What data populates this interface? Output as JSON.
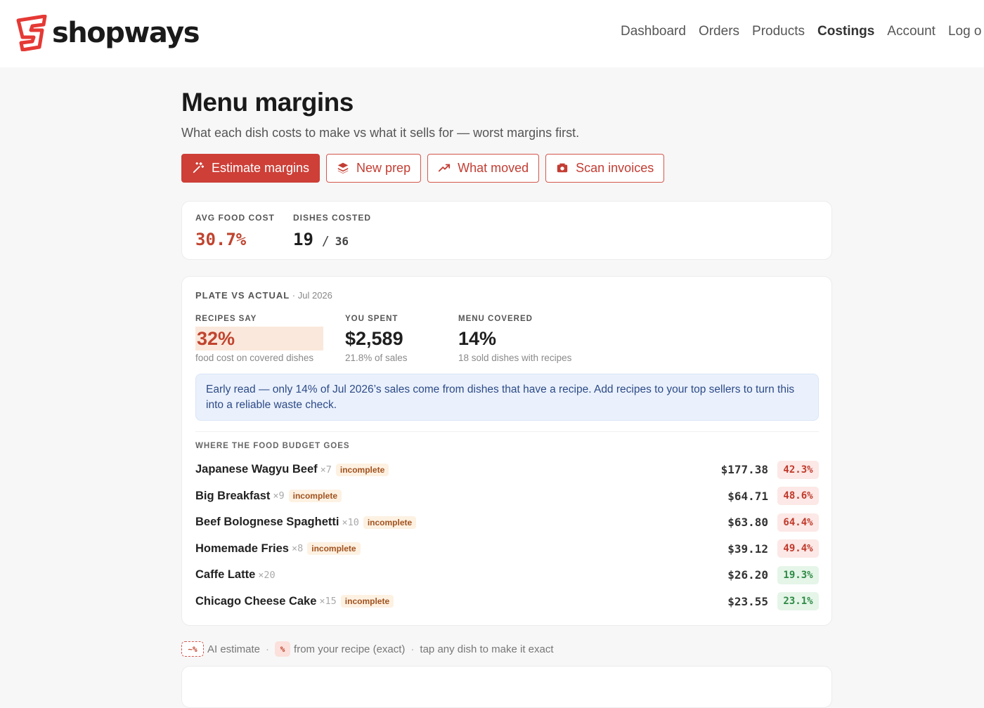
{
  "brand": {
    "name": "shopways",
    "logo_color": "#e53935"
  },
  "nav": {
    "items": [
      {
        "label": "Dashboard",
        "active": false
      },
      {
        "label": "Orders",
        "active": false
      },
      {
        "label": "Products",
        "active": false
      },
      {
        "label": "Costings",
        "active": true
      },
      {
        "label": "Account",
        "active": false
      },
      {
        "label": "Log o",
        "active": false
      }
    ]
  },
  "page": {
    "title": "Menu margins",
    "subtitle": "What each dish costs to make vs what it sells for — worst margins first."
  },
  "actions": {
    "estimate": {
      "label": "Estimate margins",
      "icon": "magic-wand-icon"
    },
    "new_prep": {
      "label": "New prep",
      "icon": "layers-icon"
    },
    "what_moved": {
      "label": "What moved",
      "icon": "trend-up-icon"
    },
    "scan_invoices": {
      "label": "Scan invoices",
      "icon": "camera-icon"
    }
  },
  "summary": {
    "avg_food_cost_label": "AVG FOOD COST",
    "avg_food_cost": "30.7%",
    "dishes_costed_label": "DISHES COSTED",
    "dishes_costed": "19",
    "dishes_total": "36"
  },
  "plate_vs_actual": {
    "title": "PLATE VS ACTUAL",
    "period": "· Jul 2026",
    "recipes_say_label": "RECIPES SAY",
    "recipes_say": "32%",
    "recipes_say_note": "food cost on covered dishes",
    "you_spent_label": "YOU SPENT",
    "you_spent": "$2,589",
    "you_spent_note": "21.8% of sales",
    "menu_covered_label": "MENU COVERED",
    "menu_covered": "14%",
    "menu_covered_note": "18 sold dishes with recipes",
    "info": "Early read — only 14% of Jul 2026’s sales come from dishes that have a recipe. Add recipes to your top sellers to turn this into a reliable waste check.",
    "budget_label": "WHERE THE FOOD BUDGET GOES",
    "dishes": [
      {
        "name": "Japanese Wagyu Beef",
        "qty": "×7",
        "badge": "incomplete",
        "amount": "$177.38",
        "pct": "42.3%",
        "status": "bad"
      },
      {
        "name": "Big Breakfast",
        "qty": "×9",
        "badge": "incomplete",
        "amount": "$64.71",
        "pct": "48.6%",
        "status": "bad"
      },
      {
        "name": "Beef Bolognese Spaghetti",
        "qty": "×10",
        "badge": "incomplete",
        "amount": "$63.80",
        "pct": "64.4%",
        "status": "bad"
      },
      {
        "name": "Homemade Fries",
        "qty": "×8",
        "badge": "incomplete",
        "amount": "$39.12",
        "pct": "49.4%",
        "status": "bad"
      },
      {
        "name": "Caffe Latte",
        "qty": "×20",
        "badge": "",
        "amount": "$26.20",
        "pct": "19.3%",
        "status": "good"
      },
      {
        "name": "Chicago Cheese Cake",
        "qty": "×15",
        "badge": "incomplete",
        "amount": "$23.55",
        "pct": "23.1%",
        "status": "good"
      }
    ]
  },
  "legend": {
    "estimate_chip": "~%",
    "estimate_label": "AI estimate",
    "exact_chip": "%",
    "exact_label": "from your recipe (exact)",
    "hint": "tap any dish to make it exact",
    "separator": "·"
  }
}
